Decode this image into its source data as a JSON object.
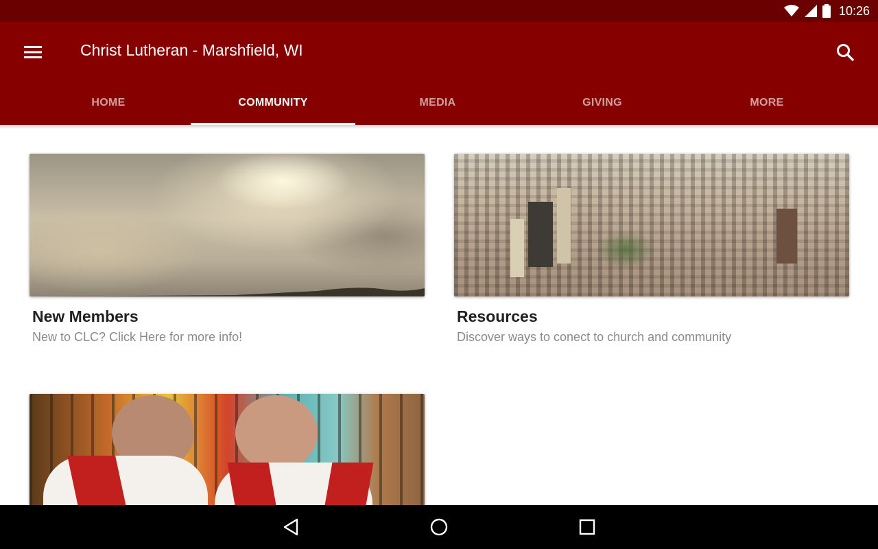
{
  "status_bar": {
    "time": "10:26",
    "icons": [
      "wifi-icon",
      "cell-signal-icon",
      "battery-icon"
    ]
  },
  "app_bar": {
    "title": "Christ Lutheran - Marshfield, WI",
    "menu_icon": "hamburger-menu-icon",
    "search_icon": "search-icon",
    "background_color": "#870000",
    "status_color": "#6a0000"
  },
  "tabs": [
    {
      "label": "HOME",
      "active": false
    },
    {
      "label": "COMMUNITY",
      "active": true
    },
    {
      "label": "MEDIA",
      "active": false
    },
    {
      "label": "GIVING",
      "active": false
    },
    {
      "label": "MORE",
      "active": false
    }
  ],
  "cards": [
    {
      "title": "New Members",
      "subtitle": "New to CLC?  Click Here for more info!",
      "image": "sky-clouds-photo"
    },
    {
      "title": "Resources",
      "subtitle": "Discover ways to conect to church and community",
      "image": "city-aerial-photo"
    },
    {
      "title": "",
      "subtitle": "",
      "image": "clergy-stained-glass-photo"
    }
  ],
  "nav_bar": {
    "icons": [
      "back-icon",
      "home-icon",
      "recents-icon"
    ]
  }
}
